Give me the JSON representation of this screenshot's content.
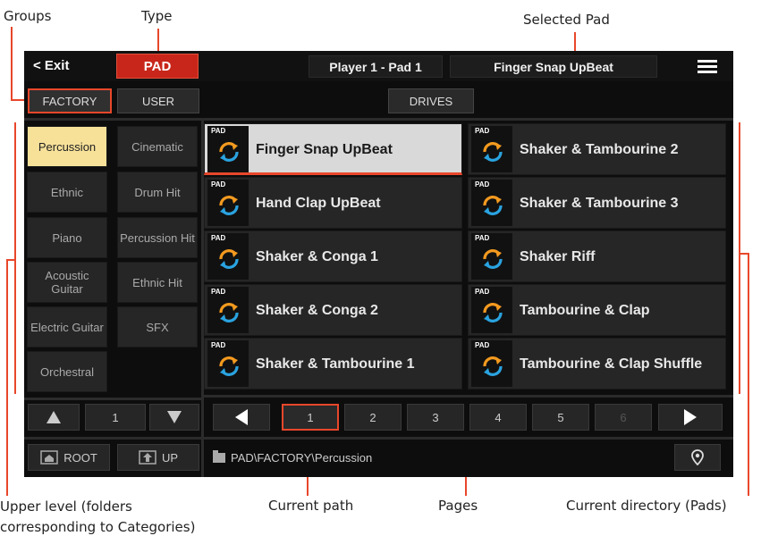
{
  "callouts": {
    "groups": "Groups",
    "type": "Type",
    "selected_pad": "Selected Pad",
    "upper_level_line1": "Upper level (folders",
    "upper_level_line2": "corresponding to Categories)",
    "current_path": "Current path",
    "pages": "Pages",
    "current_directory": "Current directory (Pads)"
  },
  "header": {
    "exit_label": "< Exit",
    "type_label": "PAD",
    "player_label": "Player 1 - Pad 1",
    "selected_pad": "Finger Snap UpBeat",
    "menu_icon": "hamburger-menu-icon"
  },
  "tabs": {
    "factory": "FACTORY",
    "user": "USER",
    "drives": "DRIVES"
  },
  "categories": [
    "Percussion",
    "Cinematic",
    "Ethnic",
    "Drum Hit",
    "Piano",
    "Percussion Hit",
    "Acoustic Guitar",
    "Ethnic Hit",
    "Electric Guitar",
    "SFX",
    "Orchestral"
  ],
  "category_page": "1",
  "nav_buttons": {
    "root": "ROOT",
    "up": "UP"
  },
  "pad_tag": "PAD",
  "pads": [
    "Finger Snap UpBeat",
    "Shaker & Tambourine 2",
    "Hand Clap UpBeat",
    "Shaker & Tambourine 3",
    "Shaker & Conga 1",
    "Shaker Riff",
    "Shaker & Conga 2",
    "Tambourine & Clap",
    "Shaker & Tambourine 1",
    "Tambourine & Clap Shuffle"
  ],
  "pages": [
    "1",
    "2",
    "3",
    "4",
    "5",
    "6"
  ],
  "current_page": "1",
  "path": "PAD\\FACTORY\\Percussion",
  "colors": {
    "accent": "#e8472b",
    "type_button": "#c8261a",
    "selected_category": "#f7e199",
    "selected_pad": "#d9d9d9",
    "icon_blue": "#2aa3e0",
    "icon_orange": "#f39a1f"
  }
}
